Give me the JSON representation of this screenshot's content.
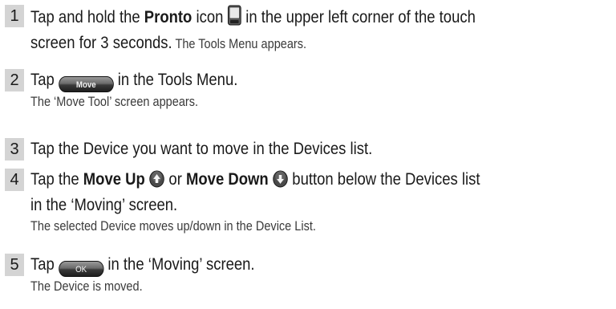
{
  "steps": [
    {
      "number": "1",
      "t1": "Tap and hold the ",
      "t1b": "Pronto",
      "t2": " icon ",
      "icon": "pronto-device-icon",
      "t3": " in the upper left corner of the touch",
      "line2": "screen for 3 seconds.",
      "line2_tail": " The Tools Menu appears."
    },
    {
      "number": "2",
      "t1": "Tap ",
      "button": "Move",
      "t2": " in the Tools Menu.",
      "sub": "The ‘Move Tool’ screen appears."
    },
    {
      "number": "3",
      "text": "Tap the Device you want to move in the Devices list."
    },
    {
      "number": "4",
      "t1": "Tap the ",
      "t1b": "Move Up",
      "icon_up": "move-up-icon",
      "t2": " or ",
      "t2b": "Move Down",
      "icon_down": "move-down-icon",
      "t3": " button below the Devices list",
      "line2": "in the ‘Moving’ screen.",
      "sub": "The selected Device moves up/down in the Device List."
    },
    {
      "number": "5",
      "t1": "Tap ",
      "button": "OK",
      "t2": " in the ‘Moving’ screen.",
      "sub": "The Device is moved."
    }
  ],
  "colors": {
    "number_box": "#d4d4d4",
    "text": "#1a1a1a",
    "button_dark": "#1e1e1e"
  }
}
